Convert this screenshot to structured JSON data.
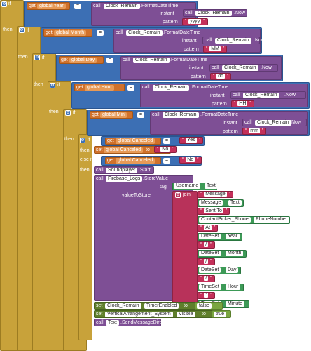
{
  "blocks": {
    "if_kw": "if",
    "then_kw": "then",
    "else_if_kw": "else if",
    "get_kw": "get",
    "set_kw": "set",
    "to_kw": "to",
    "call_kw": "call",
    "eq": "=",
    "instant_kw": "instant",
    "pattern_kw": "pattern",
    "tag_kw": "tag",
    "value_to_store_kw": "valueToStore",
    "join_kw": "join",
    "clock_component": "Clock_Remain",
    "format_method": ".FormatDateTime",
    "now_method": ".Now",
    "global_year": "global Year",
    "global_month": "global Month",
    "global_day": "global Day",
    "global_hour": "global Hour",
    "global_min": "global Min",
    "global_canceled": "global Canceled",
    "pattern_year": "yyyy",
    "pattern_month": "MM",
    "pattern_day": "dd",
    "pattern_hour": "HH",
    "pattern_min": "mm",
    "yes": "Yes",
    "no": "No",
    "soundplayer": "Soundplayer",
    "start_method": ".Start",
    "firebase": "Firebase_Logs",
    "store_method": ".StoreValue",
    "username": "Username",
    "text_prop": "Text",
    "message_str": "Message",
    "message": "Message",
    "sent_to": "Sent To",
    "contact_picker": "ContactPicker_Phone",
    "phone_number": "PhoneNumber",
    "at_sym": "At",
    "date_set": "DateSet",
    "year_prop": "Year",
    "slash": "/",
    "month_prop": "Month",
    "day_prop": "Day",
    "time_set": "TimeSet",
    "hour_prop": "Hour",
    "colon": ":",
    "minute_prop": "Minute",
    "timer_enabled": "TimerEnabled",
    "false_val": "false",
    "true_val": "true",
    "vertical_arrangement": "VerticalArrangement_System",
    "visible_prop": "Visible",
    "text_comp": "Text",
    "send_direct": ".SendMessageDirect"
  }
}
